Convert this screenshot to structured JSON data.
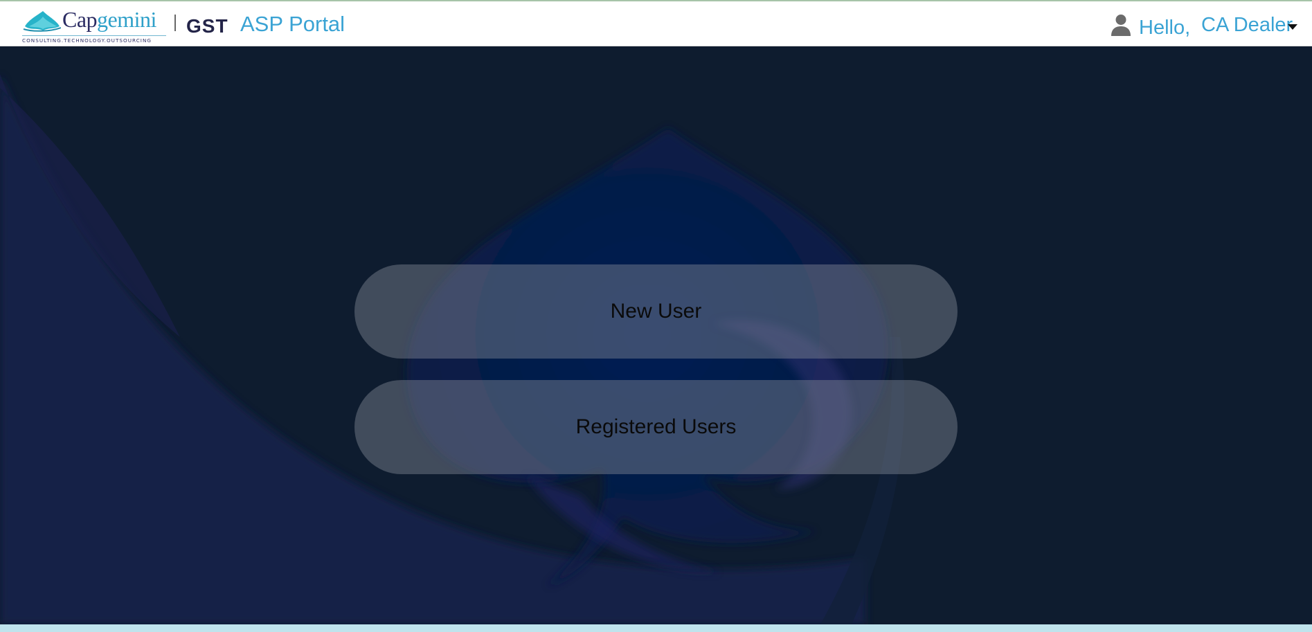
{
  "header": {
    "logo": {
      "brand_part1": "Cap",
      "brand_part2": "gemini",
      "tagline": "CONSULTING.TECHNOLOGY.OUTSOURCING"
    },
    "product": "GST",
    "portal_title": "ASP Portal",
    "greeting": "Hello,",
    "user_name": "CA Dealer",
    "user_icon": "user-icon",
    "dropdown_icon": "caret-down-icon"
  },
  "main": {
    "buttons": [
      {
        "label": "New User"
      },
      {
        "label": "Registered Users"
      }
    ]
  },
  "colors": {
    "accent": "#3aa3d4",
    "brand_navy": "#2a2b62",
    "background": "#0e1c2f",
    "button_fill": "#7f8894"
  }
}
